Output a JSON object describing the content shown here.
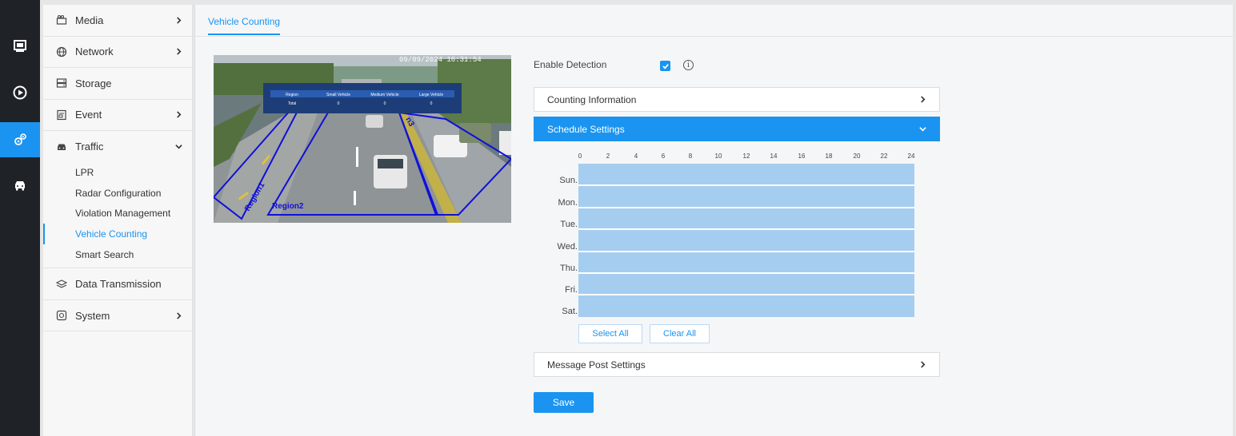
{
  "menu": {
    "items": [
      {
        "label": "Media",
        "arrow": "right"
      },
      {
        "label": "Network",
        "arrow": "right"
      },
      {
        "label": "Storage",
        "arrow": ""
      },
      {
        "label": "Event",
        "arrow": "right"
      },
      {
        "label": "Traffic",
        "arrow": "down"
      }
    ],
    "traffic_sub": [
      "LPR",
      "Radar Configuration",
      "Violation Management",
      "Vehicle Counting",
      "Smart Search"
    ],
    "after": [
      {
        "label": "Data Transmission",
        "arrow": ""
      },
      {
        "label": "System",
        "arrow": "right"
      }
    ]
  },
  "tab": {
    "label": "Vehicle Counting"
  },
  "preview": {
    "timestamp": "09/09/2024 16:31:54",
    "overlay_headers": [
      "Region",
      "Small Vehicle",
      "Medium Vehicle",
      "Large Vehicle"
    ],
    "overlay_row": [
      "Total",
      "0",
      "0",
      "0"
    ],
    "regions": [
      "Region1",
      "Region2",
      "n3"
    ]
  },
  "settings": {
    "enable_label": "Enable Detection",
    "enable_checked": true,
    "counting_info": "Counting Information",
    "schedule_settings": "Schedule Settings",
    "message_post": "Message Post Settings",
    "save": "Save"
  },
  "schedule": {
    "hours": [
      "0",
      "2",
      "4",
      "6",
      "8",
      "10",
      "12",
      "14",
      "16",
      "18",
      "20",
      "22",
      "24"
    ],
    "days": [
      "Sun.",
      "Mon.",
      "Tue.",
      "Wed.",
      "Thu.",
      "Fri.",
      "Sat."
    ],
    "select_all": "Select All",
    "clear_all": "Clear All"
  },
  "colors": {
    "accent": "#1a94f0",
    "rail": "#1f2328",
    "grid_fill": "#a5cdf0"
  }
}
